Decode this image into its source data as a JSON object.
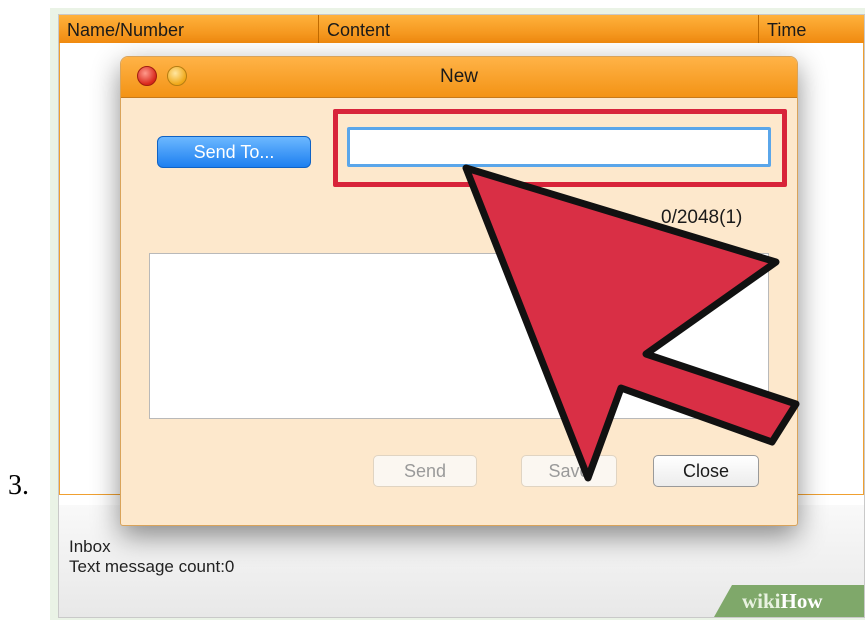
{
  "step": {
    "number": "3."
  },
  "table": {
    "columns": [
      "Name/Number",
      "Content",
      "Time"
    ]
  },
  "status": {
    "folder": "Inbox",
    "count_label": "Text message count:0"
  },
  "watermark": {
    "part1": "wiki",
    "part2": "How"
  },
  "dialog": {
    "title": "New",
    "send_to_label": "Send To...",
    "recipient_value": "",
    "char_counter": "0/2048(1)",
    "message_value": "",
    "buttons": {
      "send": "Send",
      "save": "Save",
      "close": "Close"
    }
  },
  "colors": {
    "accent_orange": "#f39315",
    "highlight_red": "#d8243a",
    "button_blue": "#1d7ff0",
    "dialog_background": "#fde8cc"
  },
  "icons": {
    "close_window": "close-window-icon",
    "minimize_window": "minimize-window-icon",
    "pointer_arrow": "pointer-arrow-icon"
  }
}
